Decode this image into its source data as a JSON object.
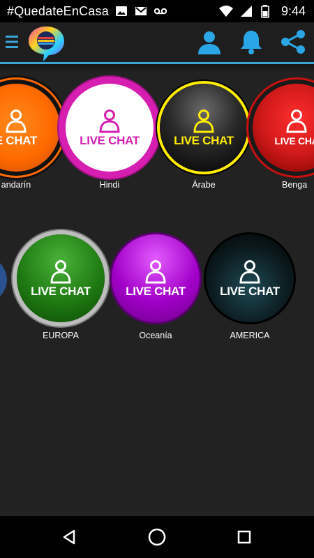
{
  "status_bar": {
    "hashtag": "#QuedateEnCasa",
    "time": "9:44",
    "icons": [
      "image-icon",
      "gmail-icon",
      "voicemail-icon",
      "wifi-icon",
      "signal-icon",
      "battery-icon"
    ]
  },
  "app_bar": {
    "icons": [
      "menu-icon",
      "app-logo",
      "profile-icon",
      "bell-icon",
      "share-icon"
    ],
    "accent": "#3aa6d8"
  },
  "rows": [
    {
      "items": [
        {
          "label": "andarín",
          "button_text": "E CHAT",
          "color": "#ff6a00"
        },
        {
          "label": "Hindi",
          "button_text": "LIVE CHAT",
          "color": "#d61fb0"
        },
        {
          "label": "Árabe",
          "button_text": "LIVE CHAT",
          "color": "#ffee00"
        },
        {
          "label": "Benga",
          "button_text": "LIVE CHA",
          "color": "#d11a1a"
        }
      ]
    },
    {
      "items": [
        {
          "label": "EUROPA",
          "button_text": "LIVE CHAT",
          "color": "#1f7a12"
        },
        {
          "label": "Oceanía",
          "button_text": "LIVE CHAT",
          "color": "#a200c8"
        },
        {
          "label": "AMERICA",
          "button_text": "LIVE CHAT",
          "color": "#0a0a0a"
        }
      ]
    }
  ],
  "nav_bar": {
    "icons": [
      "back-icon",
      "home-icon",
      "recents-icon"
    ]
  }
}
